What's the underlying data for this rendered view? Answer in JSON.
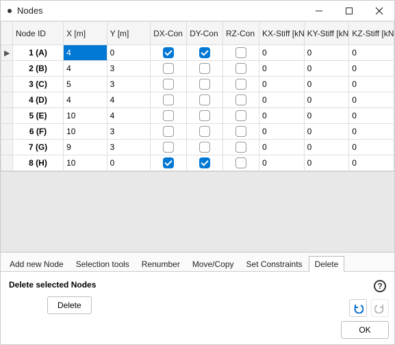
{
  "window": {
    "title": "Nodes"
  },
  "columns": {
    "id": "Node ID",
    "x": "X [m]",
    "y": "Y [m]",
    "dx": "DX-Con",
    "dy": "DY-Con",
    "rz": "RZ-Con",
    "kx": "KX-Stiff [kN/m]",
    "ky": "KY-Stiff [kN/m]",
    "kz": "KZ-Stiff [kN·m/rad]"
  },
  "rows": [
    {
      "marker": "▶",
      "id": "1 (A)",
      "x": "4",
      "y": "0",
      "dx": true,
      "dy": true,
      "rz": false,
      "kx": "0",
      "ky": "0",
      "kz": "0",
      "xsel": true
    },
    {
      "marker": "",
      "id": "2 (B)",
      "x": "4",
      "y": "3",
      "dx": false,
      "dy": false,
      "rz": false,
      "kx": "0",
      "ky": "0",
      "kz": "0"
    },
    {
      "marker": "",
      "id": "3 (C)",
      "x": "5",
      "y": "3",
      "dx": false,
      "dy": false,
      "rz": false,
      "kx": "0",
      "ky": "0",
      "kz": "0"
    },
    {
      "marker": "",
      "id": "4 (D)",
      "x": "4",
      "y": "4",
      "dx": false,
      "dy": false,
      "rz": false,
      "kx": "0",
      "ky": "0",
      "kz": "0"
    },
    {
      "marker": "",
      "id": "5 (E)",
      "x": "10",
      "y": "4",
      "dx": false,
      "dy": false,
      "rz": false,
      "kx": "0",
      "ky": "0",
      "kz": "0"
    },
    {
      "marker": "",
      "id": "6 (F)",
      "x": "10",
      "y": "3",
      "dx": false,
      "dy": false,
      "rz": false,
      "kx": "0",
      "ky": "0",
      "kz": "0"
    },
    {
      "marker": "",
      "id": "7 (G)",
      "x": "9",
      "y": "3",
      "dx": false,
      "dy": false,
      "rz": false,
      "kx": "0",
      "ky": "0",
      "kz": "0"
    },
    {
      "marker": "",
      "id": "8 (H)",
      "x": "10",
      "y": "0",
      "dx": true,
      "dy": true,
      "rz": false,
      "kx": "0",
      "ky": "0",
      "kz": "0"
    }
  ],
  "tabs": {
    "add": "Add new Node",
    "sel": "Selection tools",
    "renum": "Renumber",
    "move": "Move/Copy",
    "cons": "Set Constraints",
    "del": "Delete",
    "active": "del"
  },
  "panel": {
    "title": "Delete selected Nodes",
    "delete_btn": "Delete",
    "ok_btn": "OK"
  }
}
